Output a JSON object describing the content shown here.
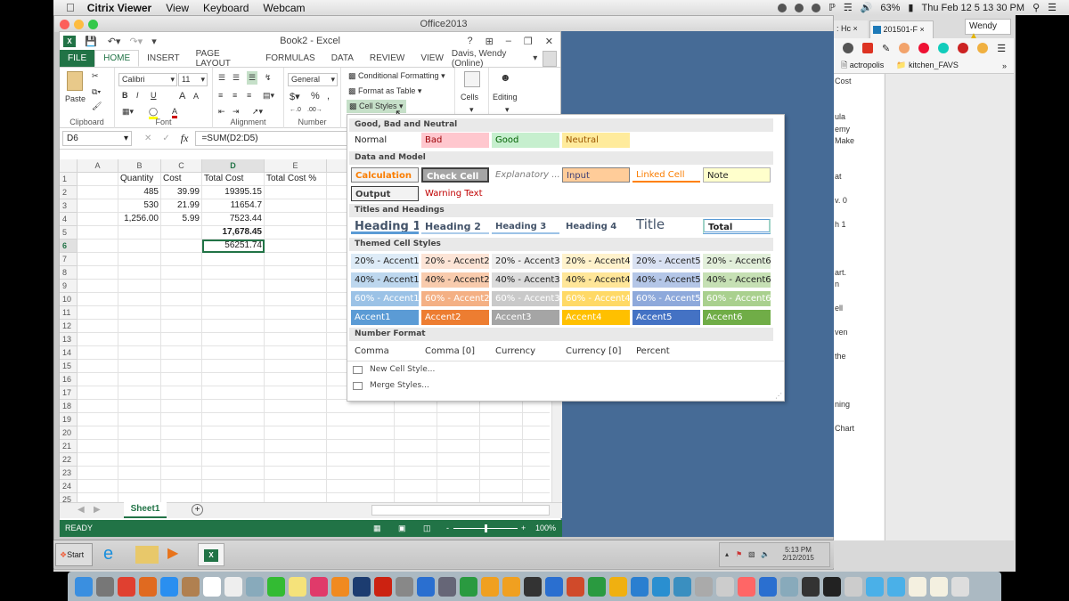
{
  "mac_menubar": {
    "app_name": "Citrix Viewer",
    "menus": [
      "View",
      "Keyboard",
      "Webcam"
    ],
    "battery": "63%",
    "clock": "Thu Feb 12  5 13 30 PM"
  },
  "citrix_window": {
    "title": "Office2013"
  },
  "excel": {
    "window_title": "Book2 - Excel",
    "help": "?",
    "tabs": [
      "FILE",
      "HOME",
      "INSERT",
      "PAGE LAYOUT",
      "FORMULAS",
      "DATA",
      "REVIEW",
      "VIEW"
    ],
    "active_tab": "HOME",
    "user": "Davis, Wendy (Online)",
    "ribbon": {
      "clipboard": {
        "paste": "Paste",
        "label": "Clipboard"
      },
      "font": {
        "name": "Calibri",
        "size": "11",
        "bold": "B",
        "italic": "I",
        "underline": "U",
        "grow": "A",
        "shrink": "A",
        "label": "Font"
      },
      "alignment": {
        "label": "Alignment"
      },
      "number": {
        "format": "General",
        "currency": "$",
        "percent": "%",
        "comma": ",",
        "label": "Number"
      },
      "styles": {
        "conditional": "Conditional Formatting",
        "format_table": "Format as Table",
        "cell_styles": "Cell Styles"
      },
      "cells": {
        "label": "Cells"
      },
      "editing": {
        "label": "Editing"
      }
    },
    "formula_bar": {
      "name_box": "D6",
      "formula": "=SUM(D2:D5)",
      "fx": "fx"
    },
    "columns": [
      "A",
      "B",
      "C",
      "D",
      "E"
    ],
    "rows": [
      "1",
      "2",
      "3",
      "4",
      "5",
      "6",
      "7",
      "8",
      "9",
      "10",
      "11",
      "12",
      "13",
      "14",
      "15",
      "16",
      "17",
      "18",
      "19",
      "20",
      "21",
      "22",
      "23",
      "24",
      "25"
    ],
    "cells": {
      "B1": "Quantity",
      "C1": "Cost",
      "D1": "Total Cost",
      "E1": "Total Cost %",
      "B2": "485",
      "C2": "39.99",
      "D2": "19395.15",
      "B3": "530",
      "C3": "21.99",
      "D3": "11654.7",
      "B4": "1,256.00",
      "C4": "5.99",
      "D4": "7523.44",
      "D5": "17,678.45",
      "D6": "56251.74"
    },
    "selected_cell": "D6",
    "sheet_tab": "Sheet1",
    "status": "READY",
    "zoom": "100%",
    "zoom_value_percent": 100
  },
  "cell_styles_gallery": {
    "sections": [
      {
        "title": "Good, Bad and Neutral",
        "items": [
          "Normal",
          "Bad",
          "Good",
          "Neutral"
        ]
      },
      {
        "title": "Data and Model",
        "items": [
          "Calculation",
          "Check Cell",
          "Explanatory ...",
          "Input",
          "Linked Cell",
          "Note",
          "Output",
          "Warning Text"
        ]
      },
      {
        "title": "Titles and Headings",
        "items": [
          "Heading 1",
          "Heading 2",
          "Heading 3",
          "Heading 4",
          "Title",
          "Total"
        ]
      },
      {
        "title": "Themed Cell Styles",
        "items": [
          "20% - Accent1",
          "20% - Accent2",
          "20% - Accent3",
          "20% - Accent4",
          "20% - Accent5",
          "20% - Accent6",
          "40% - Accent1",
          "40% - Accent2",
          "40% - Accent3",
          "40% - Accent4",
          "40% - Accent5",
          "40% - Accent6",
          "60% - Accent1",
          "60% - Accent2",
          "60% - Accent3",
          "60% - Accent4",
          "60% - Accent5",
          "60% - Accent6",
          "Accent1",
          "Accent2",
          "Accent3",
          "Accent4",
          "Accent5",
          "Accent6"
        ]
      },
      {
        "title": "Number Format",
        "items": [
          "Comma",
          "Comma [0]",
          "Currency",
          "Currency [0]",
          "Percent"
        ]
      }
    ],
    "menu": [
      "New Cell Style...",
      "Merge Styles..."
    ]
  },
  "accent_colors": [
    "#5b9bd5",
    "#ed7d31",
    "#a5a5a5",
    "#ffc000",
    "#4472c4",
    "#70ad47"
  ],
  "browser": {
    "tabs": [
      ": Hc",
      "201501-F"
    ],
    "profile": "Wendy",
    "bookmarks": [
      "actropolis",
      "kitchen_FAVS"
    ],
    "page_fragments": [
      "Cost",
      "ula",
      "emy",
      "Make",
      "at",
      "v. 0",
      "h 1",
      "art.",
      "n",
      "ell",
      "ven",
      "the",
      "ning",
      "Chart"
    ]
  },
  "windows_taskbar": {
    "start": "Start",
    "time": "5:13 PM",
    "date": "2/12/2015"
  }
}
